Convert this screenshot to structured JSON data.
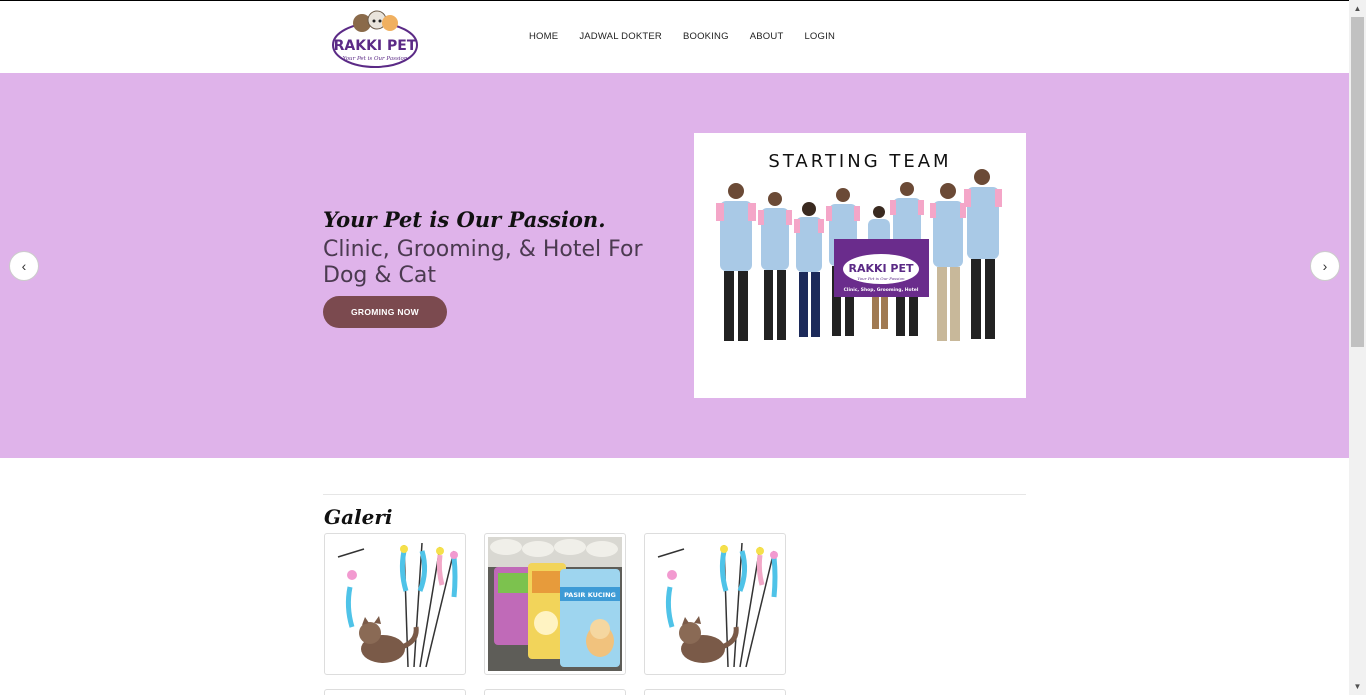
{
  "brand": {
    "name": "RAKKI PET",
    "tagline": "Your Pet is Our Passion"
  },
  "nav": {
    "items": [
      "HOME",
      "JADWAL DOKTER",
      "BOOKING",
      "ABOUT",
      "LOGIN"
    ]
  },
  "hero": {
    "tagline": "Your Pet is Our Passion.",
    "subtitle": "Clinic, Grooming, & Hotel For Dog & Cat",
    "button_label": "GROMING NOW",
    "photo": {
      "title": "STARTING TEAM",
      "banner_name": "RAKKI PET",
      "banner_tagline": "Your Pet is Our Passion",
      "banner_services": "Clinic, Shop, Grooming, Hotel"
    },
    "prev_icon": "chevron-left-icon",
    "next_icon": "chevron-right-icon"
  },
  "gallery": {
    "title": "Galeri",
    "items": [
      {
        "subject": "cat-toy-feather-wands"
      },
      {
        "subject": "cat-litter-bags",
        "label": "PASIR KUCING"
      },
      {
        "subject": "cat-toy-feather-wands"
      }
    ]
  },
  "colors": {
    "hero_bg": "#dfb3ea",
    "button_bg": "#7b4a4f",
    "brand_purple": "#5b2a86"
  }
}
